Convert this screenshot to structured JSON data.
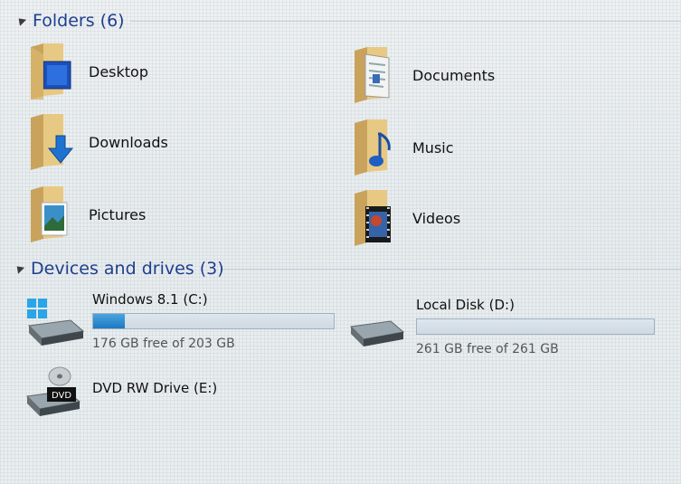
{
  "folders_header": "Folders (6)",
  "folders": [
    {
      "label": "Desktop",
      "icon": "desktop-folder-icon"
    },
    {
      "label": "Documents",
      "icon": "documents-folder-icon"
    },
    {
      "label": "Downloads",
      "icon": "downloads-folder-icon"
    },
    {
      "label": "Music",
      "icon": "music-folder-icon"
    },
    {
      "label": "Pictures",
      "icon": "pictures-folder-icon"
    },
    {
      "label": "Videos",
      "icon": "videos-folder-icon"
    }
  ],
  "devices_header": "Devices and drives (3)",
  "drives": [
    {
      "name": "Windows 8.1 (C:)",
      "free_text": "176 GB free of 203 GB",
      "used_fraction": 0.133
    },
    {
      "name": "Local Disk (D:)",
      "free_text": "261 GB free of 261 GB",
      "used_fraction": 0.0
    },
    {
      "name": "DVD RW Drive (E:)",
      "badge": "DVD"
    }
  ],
  "colors": {
    "header": "#1f3f8f",
    "folder": "#e2c07a",
    "bar_fill": "#1d79c2"
  }
}
